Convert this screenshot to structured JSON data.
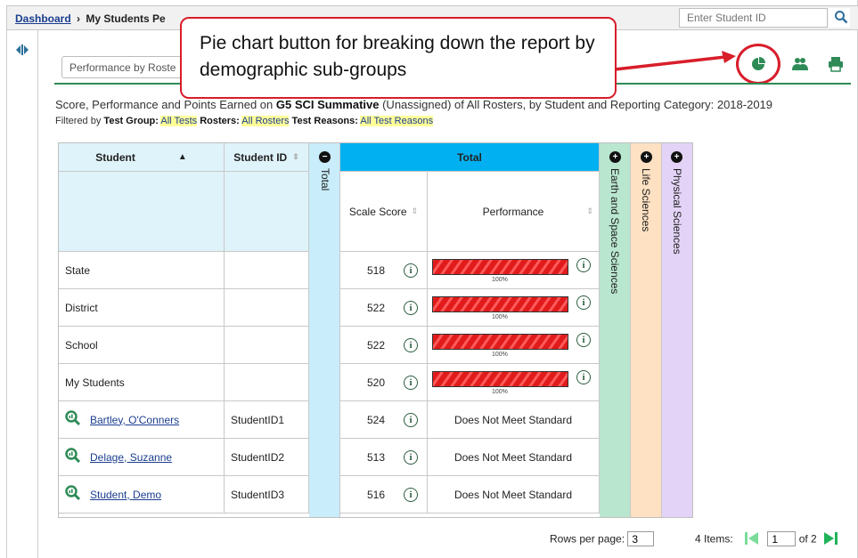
{
  "breadcrumb": {
    "home": "Dashboard",
    "separator": "›",
    "current": "My Students Pe"
  },
  "search": {
    "placeholder": "Enter Student ID",
    "icon": "search-icon"
  },
  "roster_select": {
    "value": "Performance by Roste"
  },
  "callout": {
    "text": "Pie chart button for breaking down the report by demographic sub-groups"
  },
  "report": {
    "title_pre": "Score, Performance and Points Earned on ",
    "title_bold": "G5 SCI Summative",
    "title_post": " (Unassigned) of All Rosters, by Student and Reporting Category: 2018-2019",
    "filters": {
      "lead": "Filtered by ",
      "test_group_label": "Test Group:",
      "test_group": "All Tests",
      "rosters_label": "Rosters:",
      "rosters": "All Rosters",
      "reasons_label": "Test Reasons:",
      "reasons": "All Test Reasons"
    }
  },
  "table": {
    "col_student": "Student",
    "col_student_id": "Student ID",
    "col_total_collapsed": "Total",
    "col_total": "Total",
    "col_scale_score": "Scale Score",
    "col_performance": "Performance",
    "categories": [
      "Earth and Space Sciences",
      "Life Sciences",
      "Physical Sciences"
    ],
    "category_colors": [
      "#b9e6cf",
      "#fde1c2",
      "#e3d4f7"
    ],
    "summary_rows": [
      {
        "name": "State",
        "score": "518",
        "pct": "100%",
        "fill": 1.0
      },
      {
        "name": "District",
        "score": "522",
        "pct": "100%",
        "fill": 1.0
      },
      {
        "name": "School",
        "score": "522",
        "pct": "100%",
        "fill": 1.0
      },
      {
        "name": "My Students",
        "score": "520",
        "pct": "100%",
        "fill": 1.0
      }
    ],
    "student_rows": [
      {
        "name": "Bartley, O'Conners",
        "id": "StudentID1",
        "score": "524",
        "performance": "Does Not Meet Standard"
      },
      {
        "name": "Delage, Suzanne",
        "id": "StudentID2",
        "score": "513",
        "performance": "Does Not Meet Standard"
      },
      {
        "name": "Student, Demo",
        "id": "StudentID3",
        "score": "516",
        "performance": "Does Not Meet Standard"
      }
    ]
  },
  "pager": {
    "rows_label": "Rows per page:",
    "rows_value": "3",
    "items": "4 Items:",
    "page": "1",
    "of": "of 2"
  },
  "colors": {
    "accent_green": "#2e8b57",
    "callout_red": "#d81d2a",
    "header_blue": "#00b0f0",
    "total_col": "#c9edfb"
  }
}
